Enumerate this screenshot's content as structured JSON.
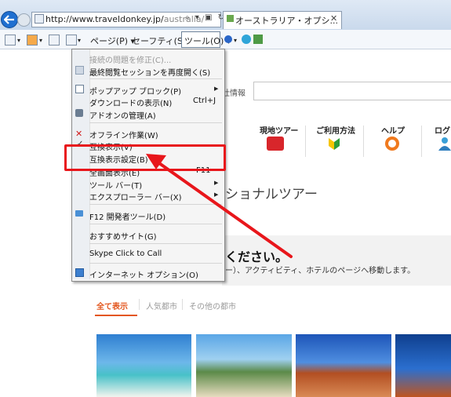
{
  "browser": {
    "address": {
      "url_main": "http://www.traveldonkey.jp/",
      "url_path": "australia/"
    },
    "tab_title": "オーストラリア・オプシ...",
    "command_bar": {
      "page_label": "ページ(P) ▾",
      "safety_label": "セーフティ(S) ▾",
      "tools_label": "ツール(O) ▾"
    }
  },
  "tools_menu": {
    "items": [
      {
        "label": "接続の問題を修正(C)...",
        "disabled": true
      },
      {
        "label": "最終閲覧セッションを再度開く(S)"
      },
      {
        "label": "ポップアップ ブロック(P)",
        "submenu": true
      },
      {
        "label": "ダウンロードの表示(N)",
        "accel": "Ctrl+J"
      },
      {
        "label": "アドオンの管理(A)"
      },
      {
        "label": "オフライン作業(W)"
      },
      {
        "label": "互換表示(V)"
      },
      {
        "label": "互換表示設定(B)"
      },
      {
        "label": "全画面表示(E)",
        "accel": "F11"
      },
      {
        "label": "ツール バー(T)",
        "submenu": true
      },
      {
        "label": "エクスプローラー バー(X)",
        "submenu": true
      },
      {
        "label": "F12 開発者ツール(D)"
      },
      {
        "label": "おすすめサイト(G)"
      },
      {
        "label": "Skype Click to Call"
      },
      {
        "label": "インターネット オプション(O)"
      }
    ]
  },
  "page": {
    "search_label": "社情報",
    "nav": [
      {
        "label": "現地ツアー",
        "icon": "bus-icon"
      },
      {
        "label": "ご利用方法",
        "icon": "beginner-leaf-icon"
      },
      {
        "label": "ヘルプ",
        "icon": "lifebuoy-icon"
      },
      {
        "label": "ログ",
        "icon": "user-icon"
      }
    ],
    "headline": "ショナルツアー",
    "band_title": "ください。",
    "band_sub": "ー）、アクティビティ、ホテルのページへ移動します。",
    "tabs": [
      "全て表示",
      "人気都市",
      "その他の都市"
    ]
  },
  "colors": {
    "highlight": "#e8161b",
    "accent": "#e3561e"
  }
}
